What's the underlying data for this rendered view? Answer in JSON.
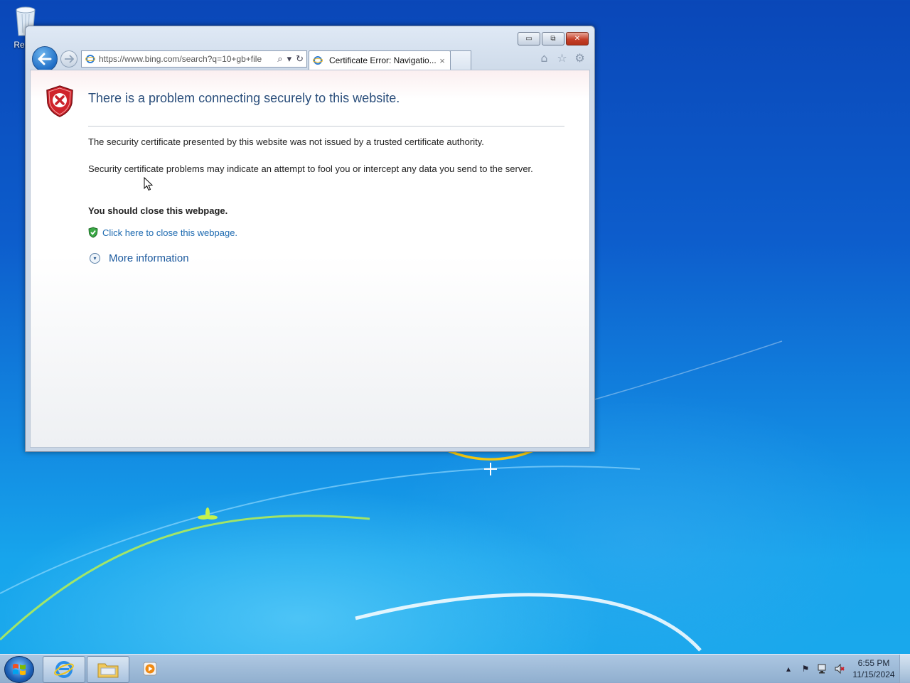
{
  "desktop": {
    "recycle_bin_label": "Recyc"
  },
  "window": {
    "minimize_label": "▭",
    "maximize_label": "⧉",
    "close_label": "✕"
  },
  "navigation": {
    "back_icon": "back-arrow-icon",
    "forward_icon": "forward-arrow-icon"
  },
  "address_bar": {
    "url": "https://www.bing.com/search?q=10+gb+file",
    "search_glyph": "⌕",
    "dropdown_glyph": "▾",
    "refresh_glyph": "↻"
  },
  "tabs": [
    {
      "title": "Certificate Error: Navigatio...",
      "close_glyph": "×"
    }
  ],
  "toolbar": {
    "home_glyph": "⌂",
    "favorites_glyph": "☆",
    "tools_glyph": "⚙"
  },
  "error_page": {
    "title": "There is a problem connecting securely to this website.",
    "paragraph1": "The security certificate presented by this website was not issued by a trusted certificate authority.",
    "paragraph2": "Security certificate problems may indicate an attempt to fool you or intercept any data you send to the server.",
    "recommendation": "You should close this webpage.",
    "close_link": "Click here to close this webpage.",
    "more_info": "More information",
    "more_glyph": "▾"
  },
  "taskbar": {
    "time": "6:55 PM",
    "date": "11/15/2024",
    "tray_up_glyph": "▴",
    "flag_glyph": "⚑"
  },
  "colors": {
    "link": "#1d6ab0",
    "title_text": "#2a4d7a",
    "error_red": "#c8202a"
  }
}
